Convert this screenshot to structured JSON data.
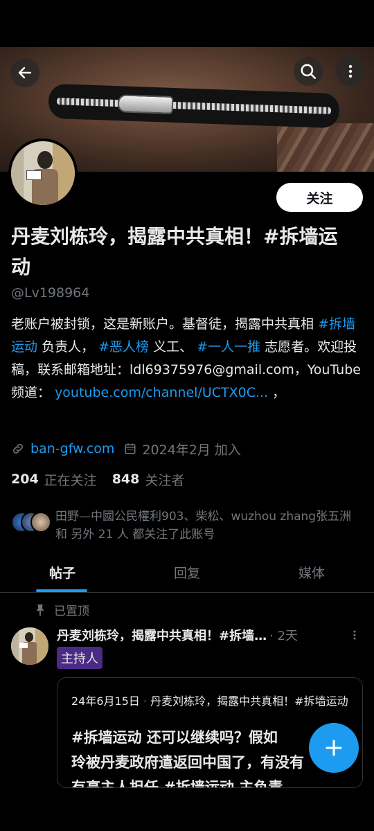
{
  "header": {
    "back_icon": "arrow-left-icon",
    "search_icon": "search-icon",
    "more_icon": "more-vertical-icon"
  },
  "profile": {
    "follow_label": "关注",
    "name_line1": "丹麦刘栋玲，揭露中共真相！#拆墙运",
    "name_line2": "动",
    "handle": "@Lv198964",
    "bio": {
      "t1": "老账户被封锁，这是新账户。基督徒，揭露中共真相",
      "tag1": "#拆墙运动",
      "t2": " 负责人，",
      "tag2": "#恶人榜",
      "t3": " 义工、",
      "tag3": "#一人一推",
      "t4": " 志愿者。欢迎投稿，联系邮箱地址：ldl69375976@gmail.com，YouTube 频道：",
      "url": "youtube.com/channel/UCTX0C...",
      "t5": "，"
    },
    "website": "ban-gfw.com",
    "joined": "2024年2月 加入",
    "following_count": "204",
    "following_label": "正在关注",
    "followers_count": "848",
    "followers_label": "关注者",
    "followed_by": "田野—中國公民權利903、柴松、wuzhou zhang张五洲 和 另外 21 人 都关注了此账号"
  },
  "tabs": [
    {
      "label": "帖子",
      "active": true
    },
    {
      "label": "回复",
      "active": false
    },
    {
      "label": "媒体",
      "active": false
    }
  ],
  "post": {
    "pinned_label": "已置顶",
    "author": "丹麦刘栋玲，揭露中共真相！#拆墙…",
    "time": "· 2天",
    "badge": "主持人",
    "quote_date": "24年6月15日",
    "quote_author": "丹麦刘栋玲，揭露中共真相！#拆墙运动",
    "quote_text_l1": "#拆墙运动 还可以继续吗？假如",
    "quote_text_l2": "玲被丹麦政府遣返回中国了，有没有",
    "quote_text_l3": "有高主人担任 #拆墙运动 主负责"
  },
  "fab": {
    "icon": "plus-icon"
  },
  "colors": {
    "accent": "#1d9bf0",
    "badge": "#4b2a86",
    "muted": "#71767b"
  }
}
